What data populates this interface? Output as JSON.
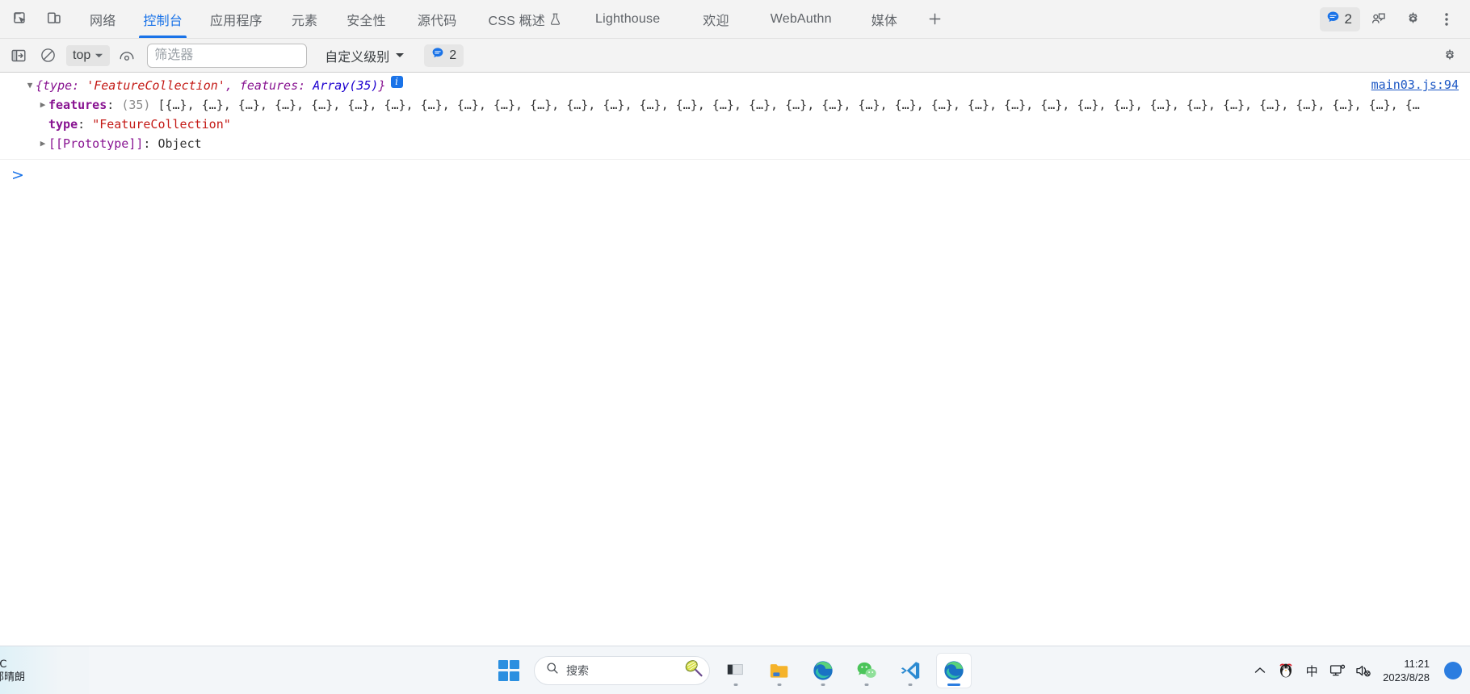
{
  "tabbar": {
    "left_icons": [
      {
        "name": "inspect-element-icon",
        "title": "检查元素"
      },
      {
        "name": "device-toolbar-icon",
        "title": "设备工具栏"
      }
    ],
    "tabs": [
      {
        "label": "网络",
        "selected": false,
        "flask": false
      },
      {
        "label": "控制台",
        "selected": true,
        "flask": false
      },
      {
        "label": "应用程序",
        "selected": false,
        "flask": false
      },
      {
        "label": "元素",
        "selected": false,
        "flask": false
      },
      {
        "label": "安全性",
        "selected": false,
        "flask": false
      },
      {
        "label": "源代码",
        "selected": false,
        "flask": false
      },
      {
        "label": "CSS 概述",
        "selected": false,
        "flask": true
      },
      {
        "label": "Lighthouse",
        "selected": false,
        "flask": false
      },
      {
        "label": "欢迎",
        "selected": false,
        "flask": false
      },
      {
        "label": "WebAuthn",
        "selected": false,
        "flask": false
      },
      {
        "label": "媒体",
        "selected": false,
        "flask": false
      }
    ],
    "add_tab_label": "+",
    "issues_count": "2",
    "right_icons": [
      {
        "name": "feedback-icon"
      },
      {
        "name": "gear-icon"
      },
      {
        "name": "more-options-icon"
      }
    ]
  },
  "console_toolbar": {
    "clear_console_label": "清空控制台",
    "no_entry_label": "禁止",
    "context": "top",
    "eye_label": "实时表达式",
    "filter_placeholder": "筛选器",
    "filter_value": "",
    "level_label": "自定义级别",
    "issues_count": "2",
    "settings_label": "设置"
  },
  "console": {
    "source_link": "main03.js:94",
    "preview": {
      "open_brace": "{",
      "key1": "type",
      "colon": ": ",
      "val1": "'FeatureCollection'",
      "comma": ", ",
      "key2": "features",
      "val2": "Array(35)",
      "close_brace": "}"
    },
    "rows": [
      {
        "expanded": true,
        "indent": "l1",
        "prop": "features",
        "count": "(35)",
        "value": "[{…}, {…}, {…}, {…}, {…}, {…}, {…}, {…}, {…}, {…}, {…}, {…}, {…}, {…}, {…}, {…}, {…}, {…}, {…}, {…}, {…}, {…}, {…}, {…}, {…}, {…}, {…}, {…}, {…}, {…}, {…}, {…}, {…}, {…}, {…"
      }
    ],
    "type_row": {
      "prop": "type",
      "value": "\"FeatureCollection\""
    },
    "proto_row": {
      "prop": "[[Prototype]]",
      "value": "Object"
    },
    "prompt": ">"
  },
  "taskbar": {
    "weather_line1": "℃",
    "weather_line2": "部晴朗",
    "search_placeholder": "搜索",
    "apps": [
      {
        "name": "task-view-icon",
        "active": false,
        "running": true
      },
      {
        "name": "file-explorer-icon",
        "active": false,
        "running": true
      },
      {
        "name": "edge-browser-icon",
        "active": false,
        "running": true
      },
      {
        "name": "wechat-icon",
        "active": false,
        "running": true
      },
      {
        "name": "vscode-icon",
        "active": false,
        "running": true
      },
      {
        "name": "edge-devtools-window-icon",
        "active": true,
        "running": true
      }
    ],
    "tray": {
      "chevron": "^",
      "qq_icon": "qq-penguin-icon",
      "ime": "中",
      "network_icon": "network-icon",
      "volume_icon": "volume-muted-icon",
      "time": "11:21",
      "date": "2023/8/28"
    }
  }
}
